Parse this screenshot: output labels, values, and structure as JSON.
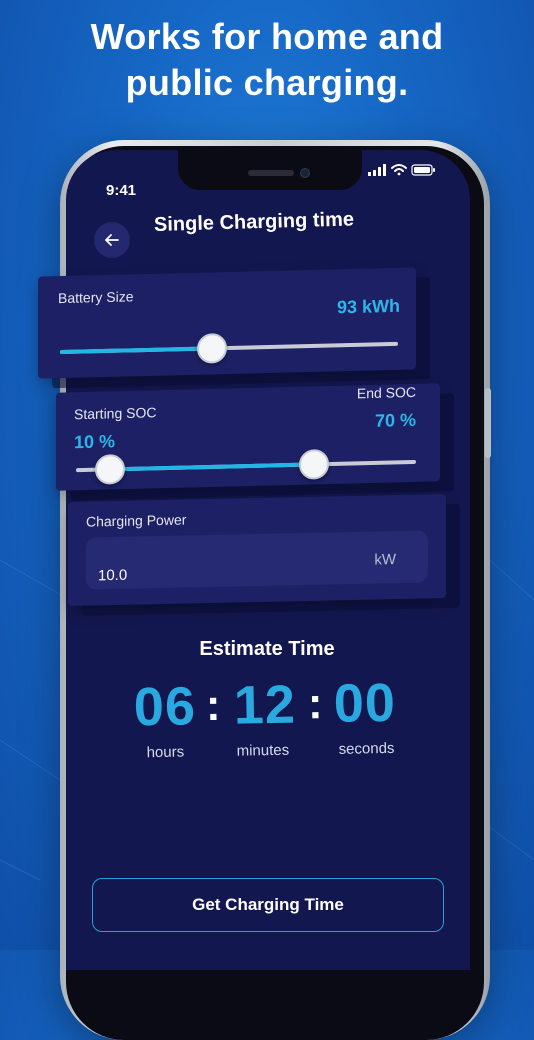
{
  "headline": {
    "line1": "Works for home and",
    "line2": "public charging."
  },
  "status_bar": {
    "time": "9:41",
    "icons": [
      "signal-icon",
      "wifi-icon",
      "battery-icon"
    ]
  },
  "header": {
    "back_icon": "arrow-left-icon",
    "title": "Single Charging time"
  },
  "battery": {
    "label": "Battery Size",
    "value": "93 kWh",
    "slider_level": 0.45
  },
  "soc": {
    "start_label": "Starting SOC",
    "start_value": "10 %",
    "end_label": "End SOC",
    "end_value": "70 %",
    "start_level": 0.1,
    "end_level": 0.7
  },
  "charging_power": {
    "label": "Charging Power",
    "value": "10.0",
    "unit": "kW"
  },
  "estimate": {
    "title": "Estimate Time",
    "hours": "06",
    "minutes": "12",
    "seconds": "00",
    "separator": ":",
    "hours_label": "hours",
    "minutes_label": "minutes",
    "seconds_label": "seconds"
  },
  "cta": {
    "label": "Get Charging Time"
  },
  "colors": {
    "screen_bg": "#13174f",
    "card_bg": "#1d2064",
    "accent": "#29a9e0",
    "page_bg": "#1666c4"
  }
}
